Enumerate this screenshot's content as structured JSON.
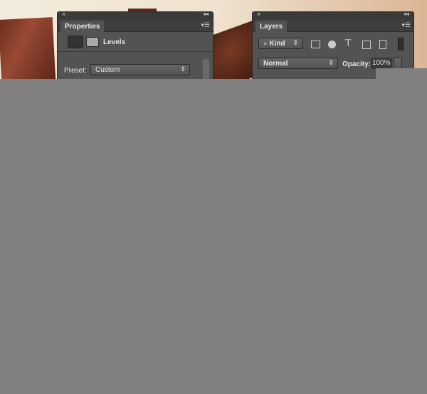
{
  "properties": {
    "tab": "Properties",
    "adjustment_title": "Levels",
    "preset_label": "Preset:",
    "preset_value": "Custom"
  },
  "layers": {
    "tab": "Layers",
    "filter_kind": "Kind",
    "blend_mode": "Normal",
    "opacity_label": "Opacity:",
    "opacity_value": "100%"
  },
  "icons": {
    "close": "×",
    "collapse": "◂◂",
    "menu": "▾☰",
    "text": "T",
    "search": "⌕",
    "updown": "⇕"
  },
  "colors": {
    "panel": "#535353",
    "overlay": "#808080"
  }
}
